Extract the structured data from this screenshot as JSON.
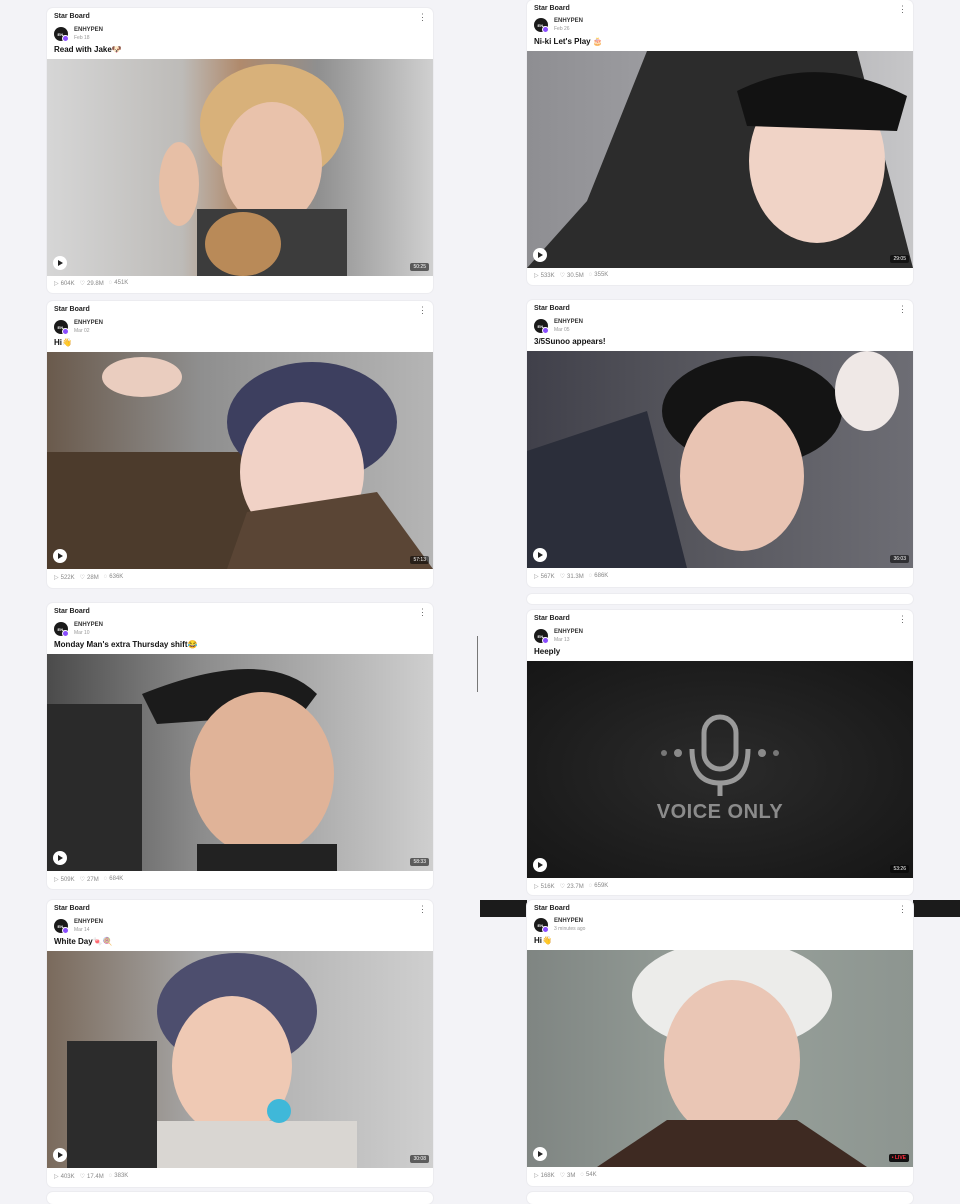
{
  "feed": {
    "board_label": "Star Board",
    "author": "ENHYPEN",
    "avatar_text": "EN-",
    "left": [
      {
        "date": "Feb 18",
        "title": "Read with Jake🐶",
        "duration": "50:25",
        "views": "604K",
        "likes": "29.8M",
        "comments": "451K"
      },
      {
        "date": "Mar 02",
        "title": "Hi👋",
        "duration": "57:13",
        "views": "522K",
        "likes": "28M",
        "comments": "636K"
      },
      {
        "date": "Mar 10",
        "title": "Monday Man's extra Thursday shift😂",
        "duration": "58:33",
        "views": "509K",
        "likes": "27M",
        "comments": "684K"
      },
      {
        "date": "Mar 14",
        "title": "White Day🍬🍭",
        "duration": "30:08",
        "views": "403K",
        "likes": "17.4M",
        "comments": "383K"
      }
    ],
    "right": [
      {
        "date": "Feb 26",
        "title": "Ni-ki Let's Play 🎂",
        "duration": "29:05",
        "views": "533K",
        "likes": "30.5M",
        "comments": "355K"
      },
      {
        "date": "Mar 05",
        "title": "3/5Sunoo appears!",
        "duration": "36:03",
        "views": "567K",
        "likes": "31.3M",
        "comments": "686K"
      },
      {
        "date": "Mar 13",
        "title": "Heeply",
        "duration": "53:26",
        "views": "516K",
        "likes": "23.7M",
        "comments": "659K",
        "voice_only": "VOICE ONLY"
      },
      {
        "date": "3 minutes ago",
        "title": "Hi👋",
        "live": "• LIVE",
        "views": "168K",
        "likes": "3M",
        "comments": "54K"
      }
    ]
  },
  "icons": {
    "play": "play-icon",
    "view": "view-icon",
    "like": "heart-icon",
    "comment": "comment-icon",
    "more": "more-icon"
  },
  "colors": {
    "background": "#f3f3f7",
    "badge": "#8a4dff",
    "live": "#ff2d3d"
  }
}
